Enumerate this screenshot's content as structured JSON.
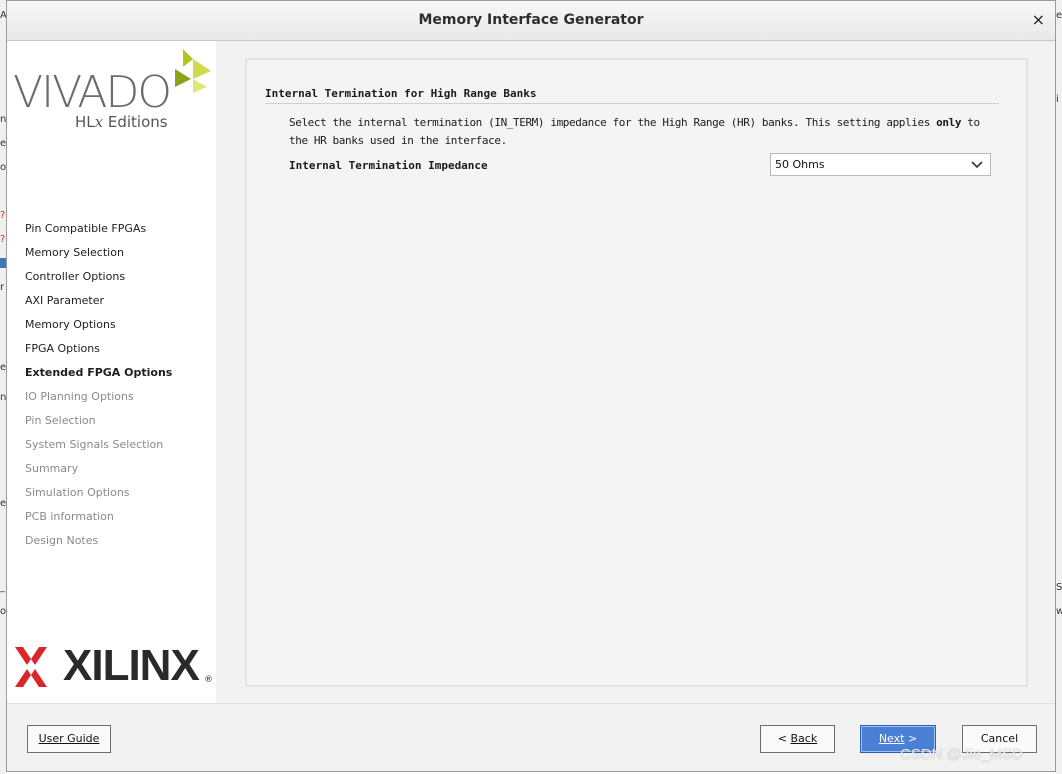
{
  "window": {
    "title": "Memory Interface Generator",
    "close_glyph": "×"
  },
  "branding": {
    "vivado_word": "VIVADO",
    "vivado_edition_prefix": "HL",
    "vivado_edition_x": "x",
    "vivado_edition_suffix": " Editions",
    "xilinx_word": "XILINX",
    "xilinx_reg": "®"
  },
  "sidebar": {
    "steps": [
      {
        "label": "Pin Compatible FPGAs",
        "state": "done"
      },
      {
        "label": "Memory Selection",
        "state": "done"
      },
      {
        "label": "Controller Options",
        "state": "done"
      },
      {
        "label": "AXI Parameter",
        "state": "done"
      },
      {
        "label": "Memory Options",
        "state": "done"
      },
      {
        "label": "FPGA Options",
        "state": "done"
      },
      {
        "label": "Extended FPGA Options",
        "state": "current"
      },
      {
        "label": "IO Planning Options",
        "state": "future"
      },
      {
        "label": "Pin Selection",
        "state": "future"
      },
      {
        "label": "System Signals Selection",
        "state": "future"
      },
      {
        "label": "Summary",
        "state": "future"
      },
      {
        "label": "Simulation Options",
        "state": "future"
      },
      {
        "label": "PCB information",
        "state": "future"
      },
      {
        "label": "Design Notes",
        "state": "future"
      }
    ]
  },
  "main": {
    "section_title": "Internal Termination for High Range Banks",
    "description_pre": "Select the internal termination (IN_TERM) impedance for the High Range (HR) banks. This setting applies ",
    "description_bold": "only",
    "description_post": " to the HR banks used in the interface.",
    "field_label": "Internal Termination Impedance",
    "select_value": "50 Ohms"
  },
  "footer": {
    "user_guide": "User Guide",
    "back_glyph": "<",
    "back": "Back",
    "next": "Next",
    "next_glyph": ">",
    "cancel": "Cancel"
  },
  "watermark": "CSDN @Jie_MSD",
  "colors": {
    "vivado_green": "#b4c424",
    "xilinx_red": "#d8262b",
    "primary_button": "#4a7fd6"
  }
}
